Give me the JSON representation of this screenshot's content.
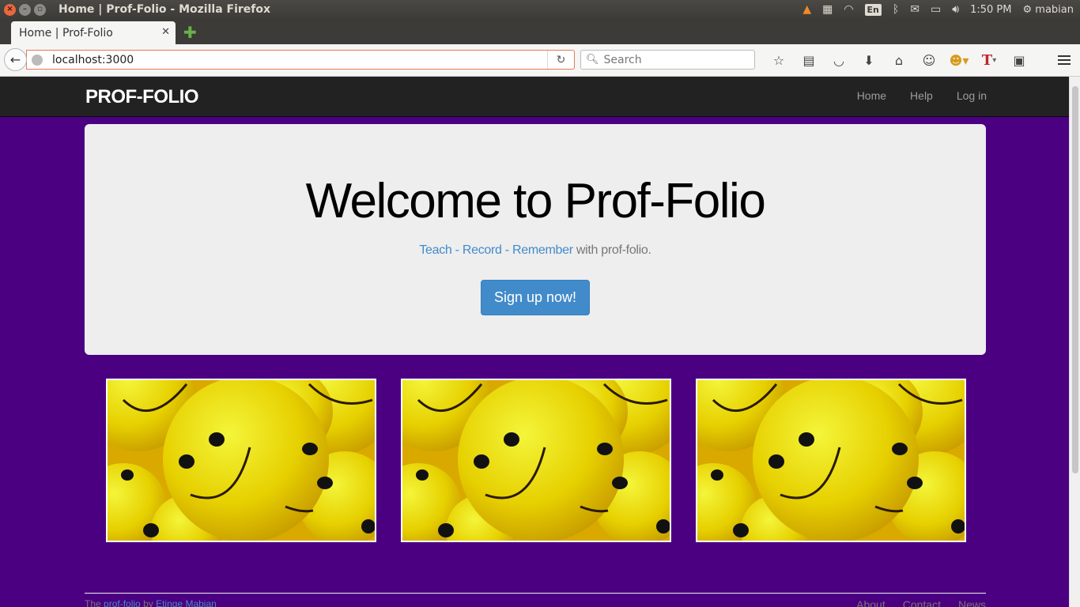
{
  "window": {
    "title": "Home | Prof-Folio - Mozilla Firefox",
    "tray": {
      "language": "En",
      "time": "1:50 PM",
      "user": "mabian"
    }
  },
  "browser": {
    "tab_title": "Home | Prof-Folio",
    "url": "localhost:3000",
    "search_placeholder": "Search"
  },
  "site": {
    "brand": "PROF-FOLIO",
    "nav": [
      "Home",
      "Help",
      "Log in"
    ],
    "hero": {
      "title": "Welcome to Prof-Folio",
      "tagline_links": [
        "Teach",
        "Record",
        "Remember"
      ],
      "tagline_suffix": "with prof-folio.",
      "cta": "Sign up now!"
    },
    "footer": {
      "prefix": "The",
      "project_link": "prof-folio",
      "by": "by",
      "author_link": "Etinge Mabian",
      "links": [
        "About",
        "Contact",
        "News"
      ]
    }
  },
  "colors": {
    "page_bg": "#4b0082",
    "navbar_bg": "#222222",
    "jumbotron_bg": "#eeeeee",
    "primary": "#428bca"
  }
}
